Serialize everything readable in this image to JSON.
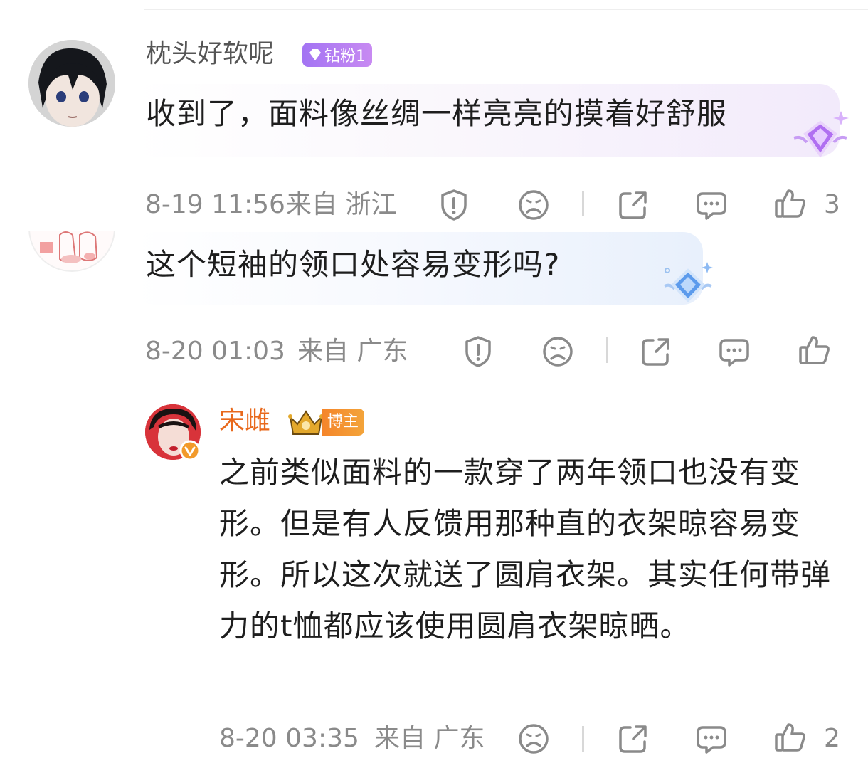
{
  "comments": [
    {
      "user": "枕头好软呢",
      "badge": "钻粉1",
      "text": "收到了，面料像丝绸一样亮亮的摸着好舒服",
      "time": "8-19 11:56",
      "location": "来自 浙江",
      "likes": "3"
    },
    {
      "user": "",
      "text": "这个短袖的领口处容易变形吗?",
      "time": "8-20 01:03",
      "location": "来自 广东",
      "likes": ""
    }
  ],
  "reply": {
    "user": "宋雌",
    "badge": "博主",
    "text": "之前类似面料的一款穿了两年领口也没有变形。但是有人反馈用那种直的衣架晾容易变形。所以这次就送了圆肩衣架。其实任何带弹力的t恤都应该使用圆肩衣架晾晒。",
    "time": "8-20 03:35",
    "location": "来自 广东",
    "likes": "2"
  },
  "icons": [
    "report-icon",
    "dislike-face-icon",
    "share-icon",
    "comment-icon",
    "like-thumb-icon",
    "verified-icon",
    "crown-icon",
    "diamond-icon"
  ],
  "colors": {
    "meta": "#8a8a8a",
    "author_name": "#e8691c",
    "fan_badge": "#b27cf0",
    "blogger_badge": "#f08a2c"
  }
}
